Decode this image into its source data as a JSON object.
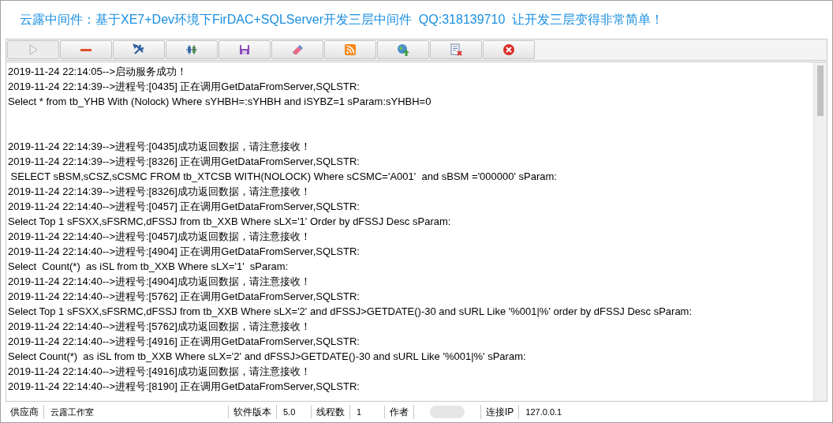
{
  "title": "云露中间件：基于XE7+Dev环境下FirDAC+SQLServer开发三层中间件  QQ:318139710  让开发三层变得非常简单！",
  "toolbar": [
    {
      "kind": "start",
      "disabled": true
    },
    {
      "kind": "stop",
      "disabled": false
    },
    {
      "kind": "tools",
      "disabled": false
    },
    {
      "kind": "connect",
      "disabled": false
    },
    {
      "kind": "save",
      "disabled": false
    },
    {
      "kind": "erase",
      "disabled": false
    },
    {
      "kind": "feed",
      "disabled": false
    },
    {
      "kind": "globe",
      "disabled": false
    },
    {
      "kind": "delete-doc",
      "disabled": false
    },
    {
      "kind": "exit",
      "disabled": false
    }
  ],
  "log": [
    "2019-11-24 22:14:05-->启动服务成功！",
    "2019-11-24 22:14:39-->进程号:[0435] 正在调用GetDataFromServer,SQLSTR:",
    "Select * from tb_YHB With (Nolock) Where sYHBH=:sYHBH and iSYBZ=1 sParam:sYHBH=0",
    {
      "kind": "blank"
    },
    {
      "kind": "blank"
    },
    "2019-11-24 22:14:39-->进程号:[0435]成功返回数据，请注意接收！",
    "2019-11-24 22:14:39-->进程号:[8326] 正在调用GetDataFromServer,SQLSTR:",
    " SELECT sBSM,sCSZ,sCSMC FROM tb_XTCSB WITH(NOLOCK) Where sCSMC='A001'  and sBSM ='000000' sParam:",
    "2019-11-24 22:14:39-->进程号:[8326]成功返回数据，请注意接收！",
    "2019-11-24 22:14:40-->进程号:[0457] 正在调用GetDataFromServer,SQLSTR:",
    "Select Top 1 sFSXX,sFSRMC,dFSSJ from tb_XXB Where sLX='1' Order by dFSSJ Desc sParam:",
    "2019-11-24 22:14:40-->进程号:[0457]成功返回数据，请注意接收！",
    "2019-11-24 22:14:40-->进程号:[4904] 正在调用GetDataFromServer,SQLSTR:",
    "Select  Count(*)  as iSL from tb_XXB Where sLX='1'  sParam:",
    "2019-11-24 22:14:40-->进程号:[4904]成功返回数据，请注意接收！",
    "2019-11-24 22:14:40-->进程号:[5762] 正在调用GetDataFromServer,SQLSTR:",
    "Select Top 1 sFSXX,sFSRMC,dFSSJ from tb_XXB Where sLX='2' and dFSSJ>GETDATE()-30 and sURL Like '%001|%' order by dFSSJ Desc sParam:",
    "2019-11-24 22:14:40-->进程号:[5762]成功返回数据，请注意接收！",
    "2019-11-24 22:14:40-->进程号:[4916] 正在调用GetDataFromServer,SQLSTR:",
    "Select Count(*)  as iSL from tb_XXB Where sLX='2' and dFSSJ>GETDATE()-30 and sURL Like '%001|%' sParam:",
    "2019-11-24 22:14:40-->进程号:[4916]成功返回数据，请注意接收！",
    "2019-11-24 22:14:40-->进程号:[8190] 正在调用GetDataFromServer,SQLSTR:"
  ],
  "status_bar": [
    {
      "kind": "text",
      "label": "供应商",
      "value": "云露工作室"
    },
    {
      "kind": "text",
      "label": "软件版本",
      "value": "5.0"
    },
    {
      "kind": "text",
      "label": "线程数",
      "value": "1"
    },
    {
      "kind": "hidden",
      "label": "作者"
    },
    {
      "kind": "text",
      "label": "连接IP",
      "value": "127.0.0.1"
    }
  ]
}
